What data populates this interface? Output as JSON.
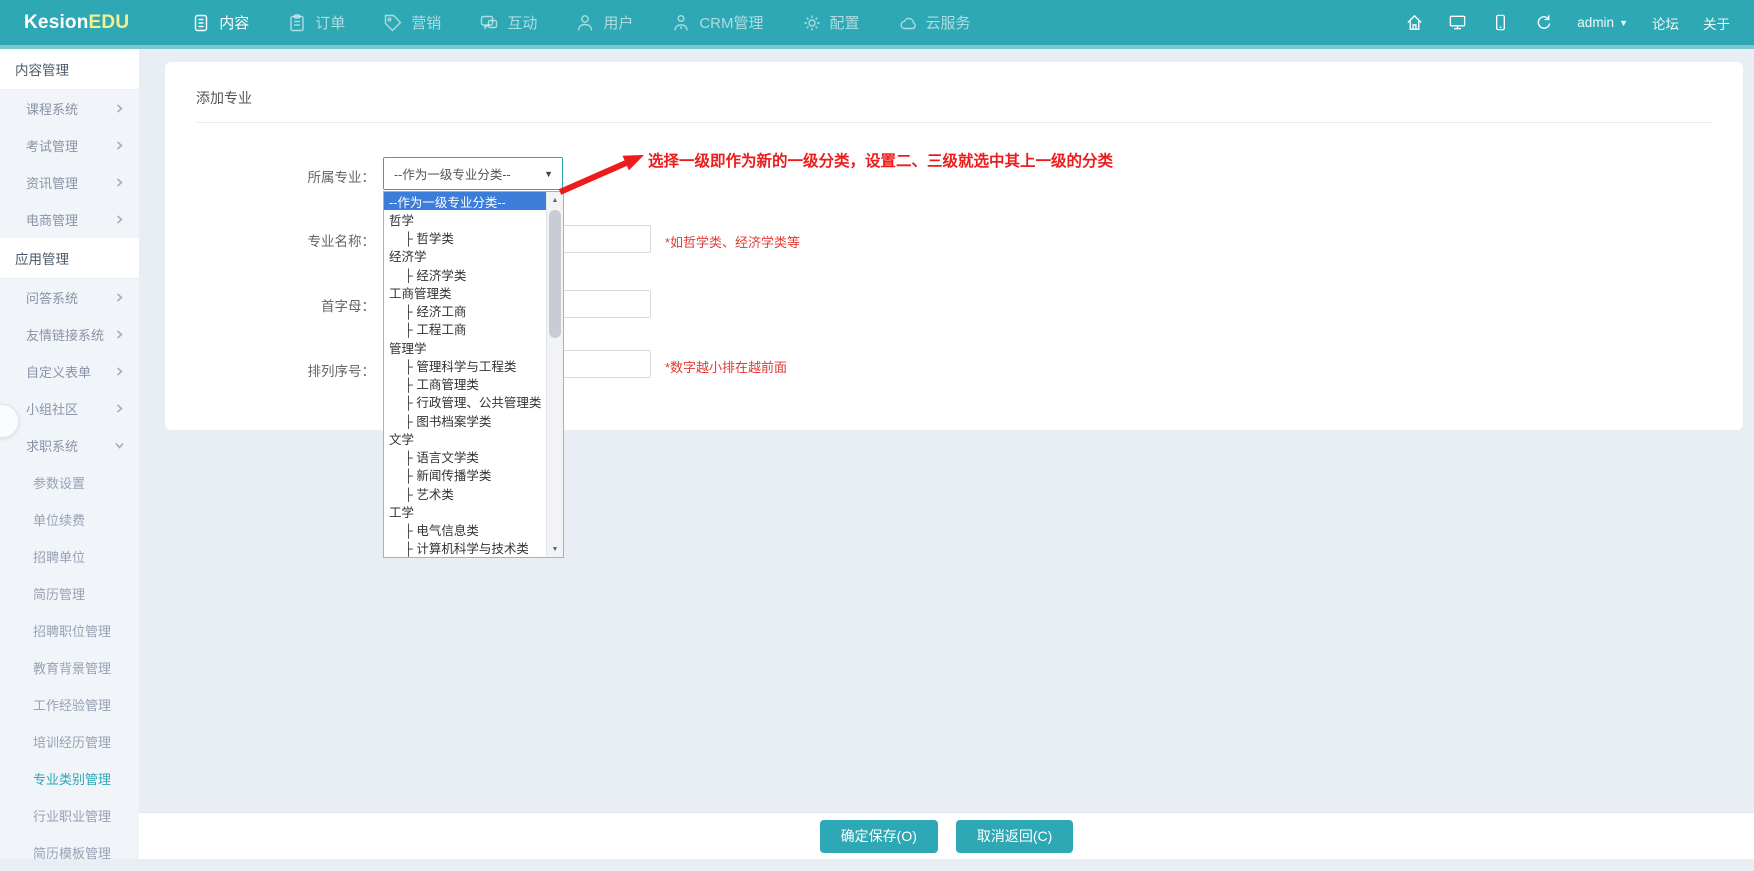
{
  "colors": {
    "accent": "#2EA8B5",
    "accent-light": "#7CC6CE",
    "highlight": "#3B7DD8",
    "red": "#ED1C1C",
    "logo-yellow": "#F6EF8D"
  },
  "navbar": {
    "logo_part1": "Kesion",
    "logo_part2": "EDU",
    "items": [
      {
        "label": "内容",
        "icon": "content-icon",
        "active": true
      },
      {
        "label": "订单",
        "icon": "order-icon",
        "active": false
      },
      {
        "label": "营销",
        "icon": "marketing-icon",
        "active": false
      },
      {
        "label": "互动",
        "icon": "interaction-icon",
        "active": false
      },
      {
        "label": "用户",
        "icon": "user-icon",
        "active": false
      },
      {
        "label": "CRM管理",
        "icon": "crm-icon",
        "active": false
      },
      {
        "label": "配置",
        "icon": "settings-icon",
        "active": false
      },
      {
        "label": "云服务",
        "icon": "cloud-icon",
        "active": false
      }
    ],
    "right": {
      "username": "admin",
      "forum_label": "论坛",
      "about_label": "关于"
    }
  },
  "sidebar": {
    "section1": {
      "header": "内容管理",
      "items": [
        {
          "label": "课程系统"
        },
        {
          "label": "考试管理"
        },
        {
          "label": "资讯管理"
        },
        {
          "label": "电商管理"
        }
      ]
    },
    "section2": {
      "header": "应用管理",
      "items": [
        {
          "label": "问答系统"
        },
        {
          "label": "友情链接系统"
        },
        {
          "label": "自定义表单"
        },
        {
          "label": "小组社区"
        },
        {
          "label": "求职系统",
          "expanded": true
        }
      ]
    },
    "job_sub_items": [
      {
        "label": "参数设置"
      },
      {
        "label": "单位续费"
      },
      {
        "label": "招聘单位"
      },
      {
        "label": "简历管理"
      },
      {
        "label": "招聘职位管理"
      },
      {
        "label": "教育背景管理"
      },
      {
        "label": "工作经验管理"
      },
      {
        "label": "培训经历管理"
      },
      {
        "label": "专业类别管理",
        "active": true
      },
      {
        "label": "行业职业管理"
      },
      {
        "label": "简历模板管理"
      }
    ]
  },
  "page": {
    "title": "添加专业"
  },
  "form": {
    "category_label": "所属专业：",
    "category_value": "--作为一级专业分类--",
    "name_label": "专业名称：",
    "name_value": "",
    "name_hint": "*如哲学类、经济学类等",
    "initial_label": "首字母：",
    "initial_value": "",
    "order_label": "排列序号：",
    "order_value": "",
    "order_hint": "*数字越小排在越前面",
    "save_label": "确定保存(O)",
    "cancel_label": "取消返回(C)"
  },
  "annotation": {
    "text": "选择一级即作为新的一级分类，设置二、三级就选中其上一级的分类"
  },
  "dropdown": {
    "options": [
      {
        "label": "--作为一级专业分类--",
        "level": 0,
        "selected": true
      },
      {
        "label": "哲学",
        "level": 0,
        "selected": false
      },
      {
        "label": "├ 哲学类",
        "level": 1,
        "selected": false
      },
      {
        "label": "经济学",
        "level": 0,
        "selected": false
      },
      {
        "label": "├ 经济学类",
        "level": 1,
        "selected": false
      },
      {
        "label": "工商管理类",
        "level": 0,
        "selected": false
      },
      {
        "label": "├ 经济工商",
        "level": 1,
        "selected": false
      },
      {
        "label": "├ 工程工商",
        "level": 1,
        "selected": false
      },
      {
        "label": "管理学",
        "level": 0,
        "selected": false
      },
      {
        "label": "├ 管理科学与工程类",
        "level": 1,
        "selected": false
      },
      {
        "label": "├ 工商管理类",
        "level": 1,
        "selected": false
      },
      {
        "label": "├ 行政管理、公共管理类",
        "level": 1,
        "selected": false
      },
      {
        "label": "├ 图书档案学类",
        "level": 1,
        "selected": false
      },
      {
        "label": "文学",
        "level": 0,
        "selected": false
      },
      {
        "label": "├ 语言文学类",
        "level": 1,
        "selected": false
      },
      {
        "label": "├ 新闻传播学类",
        "level": 1,
        "selected": false
      },
      {
        "label": "├ 艺术类",
        "level": 1,
        "selected": false
      },
      {
        "label": "工学",
        "level": 0,
        "selected": false
      },
      {
        "label": "├ 电气信息类",
        "level": 1,
        "selected": false
      },
      {
        "label": "├ 计算机科学与技术类",
        "level": 1,
        "selected": false
      }
    ]
  }
}
